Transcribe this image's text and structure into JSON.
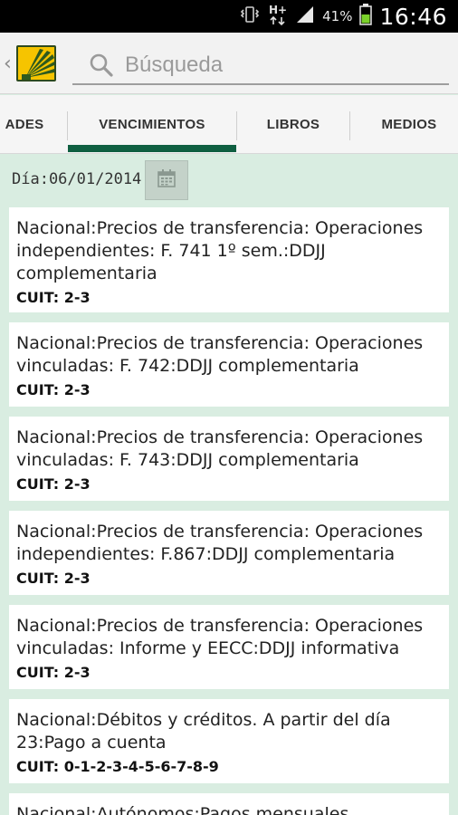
{
  "status_bar": {
    "battery_pct": "41%",
    "time": "16:46",
    "network": "H+"
  },
  "action_bar": {
    "search_placeholder": "Búsqueda",
    "back_glyph": "‹"
  },
  "tabs": [
    {
      "label": "ADES",
      "selected": false
    },
    {
      "label": "VENCIMIENTOS",
      "selected": true
    },
    {
      "label": "LIBROS",
      "selected": false
    },
    {
      "label": "MEDIOS",
      "selected": false
    }
  ],
  "date": {
    "label": "Día:06/01/2014"
  },
  "cards": [
    {
      "text": "Nacional:Precios de transferencia: Operaciones independientes: F. 741 1º sem.:DDJJ complementaria",
      "cuit": "CUIT: 2-3"
    },
    {
      "text": "Nacional:Precios de transferencia: Operaciones vinculadas: F. 742:DDJJ complementaria",
      "cuit": "CUIT: 2-3"
    },
    {
      "text": "Nacional:Precios de transferencia: Operaciones vinculadas: F. 743:DDJJ complementaria",
      "cuit": "CUIT: 2-3"
    },
    {
      "text": "Nacional:Precios de transferencia: Operaciones independientes: F.867:DDJJ complementaria",
      "cuit": "CUIT: 2-3"
    },
    {
      "text": "Nacional:Precios de transferencia: Operaciones vinculadas: Informe y EECC:DDJJ informativa",
      "cuit": "CUIT: 2-3"
    },
    {
      "text": "Nacional:Débitos y créditos. A partir del día 23:Pago a cuenta",
      "cuit": "CUIT: 0-1-2-3-4-5-6-7-8-9"
    },
    {
      "text": "Nacional:Autónomos:Pagos mensuales",
      "cuit": ""
    }
  ],
  "colors": {
    "accent": "#0f5f41",
    "background": "#d9ede1",
    "card": "#ffffff"
  }
}
